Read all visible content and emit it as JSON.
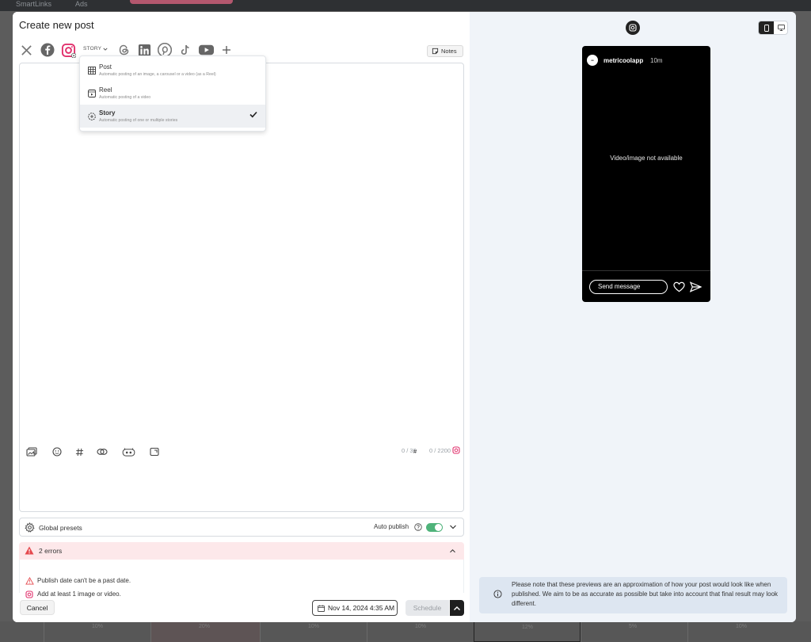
{
  "background": {
    "nav_items": [
      "SmartLinks",
      "Ads"
    ],
    "bottom_values": [
      "10%",
      "20%",
      "10%",
      "10%",
      "12%",
      "5%",
      "10%"
    ]
  },
  "modal": {
    "title": "Create new post"
  },
  "networks": [
    {
      "name": "x-twitter-icon"
    },
    {
      "name": "facebook-icon"
    },
    {
      "name": "instagram-icon",
      "selected": true
    },
    {
      "name": "threads-icon"
    },
    {
      "name": "linkedin-icon"
    },
    {
      "name": "pinterest-icon"
    },
    {
      "name": "tiktok-icon"
    },
    {
      "name": "youtube-icon"
    },
    {
      "name": "add-network-icon"
    }
  ],
  "post_type": {
    "selected": "STORY",
    "options": [
      {
        "name": "Post",
        "desc": "Automatic posting of an image, a carousel or a video (as a Reel)"
      },
      {
        "name": "Reel",
        "desc": "Automatic posting of a video"
      },
      {
        "name": "Story",
        "desc": "Automatic posting of one or multiple stories",
        "selected": true
      }
    ]
  },
  "notes_label": "Notes",
  "editor": {
    "hashtag_counter": "0 / 30",
    "char_counter": "0 / 2200"
  },
  "presets": {
    "label": "Global presets",
    "auto_publish_label": "Auto publish",
    "auto_publish_on": true
  },
  "errors": {
    "summary": "2 errors",
    "items": [
      "Publish date can't be a past date.",
      "Add at least 1 image or video."
    ]
  },
  "footer": {
    "cancel_label": "Cancel",
    "date_label": "Nov 14, 2024 4:35 AM",
    "schedule_label": "Schedule"
  },
  "preview": {
    "username": "metricoolapp",
    "time": "10m",
    "media_placeholder": "Video/image not available",
    "send_placeholder": "Send message",
    "disclaimer": "Please note that these previews are an approximation of how your post would look like when published. We aim to be as accurate as possible but take into account that final result may look different."
  },
  "colors": {
    "instagram": "#e1306c",
    "toggle_on": "#4fb37a",
    "error": "#e5484d",
    "error_bg": "#fde8ea",
    "preview_bg": "#f0f4f9"
  }
}
